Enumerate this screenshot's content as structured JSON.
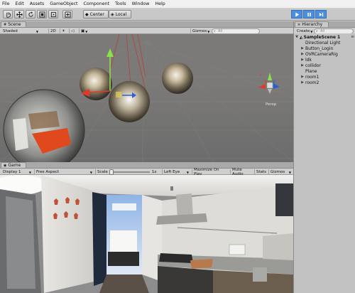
{
  "menu": [
    "File",
    "Edit",
    "Assets",
    "GameObject",
    "Component",
    "Tools",
    "Window",
    "Help"
  ],
  "toolbar": {
    "tools": [
      "hand-tool",
      "move-tool",
      "rotate-tool",
      "scale-tool",
      "rect-tool"
    ],
    "pivot_label": "Center",
    "space_label": "Local"
  },
  "scene": {
    "tab_label": "Scene",
    "shading": "Shaded",
    "mode_2d": "2D",
    "gizmos": "Gizmos",
    "search_placeholder": "All",
    "persp_label": "Persp"
  },
  "game": {
    "tab_label": "Game",
    "display": "Display 1",
    "aspect": "Free Aspect",
    "scale_label": "Scale",
    "scale_value": "1x",
    "eye": "Left Eye",
    "maximize": "Maximize On Play",
    "mute": "Mute Audio",
    "stats": "Stats",
    "gizmos": "Gizmos"
  },
  "hierarchy": {
    "tab_label": "Hierarchy",
    "create_label": "Create",
    "search_placeholder": "All",
    "scene_name": "SampleScene 1",
    "items": [
      {
        "label": "Directional Light",
        "expandable": false
      },
      {
        "label": "Button_Login",
        "expandable": true
      },
      {
        "label": "OVRCameraRig",
        "expandable": true
      },
      {
        "label": "ldk",
        "expandable": true
      },
      {
        "label": "collidor",
        "expandable": true
      },
      {
        "label": "Plane",
        "expandable": false
      },
      {
        "label": "room1",
        "expandable": true
      },
      {
        "label": "room2",
        "expandable": true
      }
    ]
  },
  "colors": {
    "play_active": "#4a8ee0",
    "panel_bg": "#c2c2c2",
    "scene_bg": "#7b7a78"
  }
}
